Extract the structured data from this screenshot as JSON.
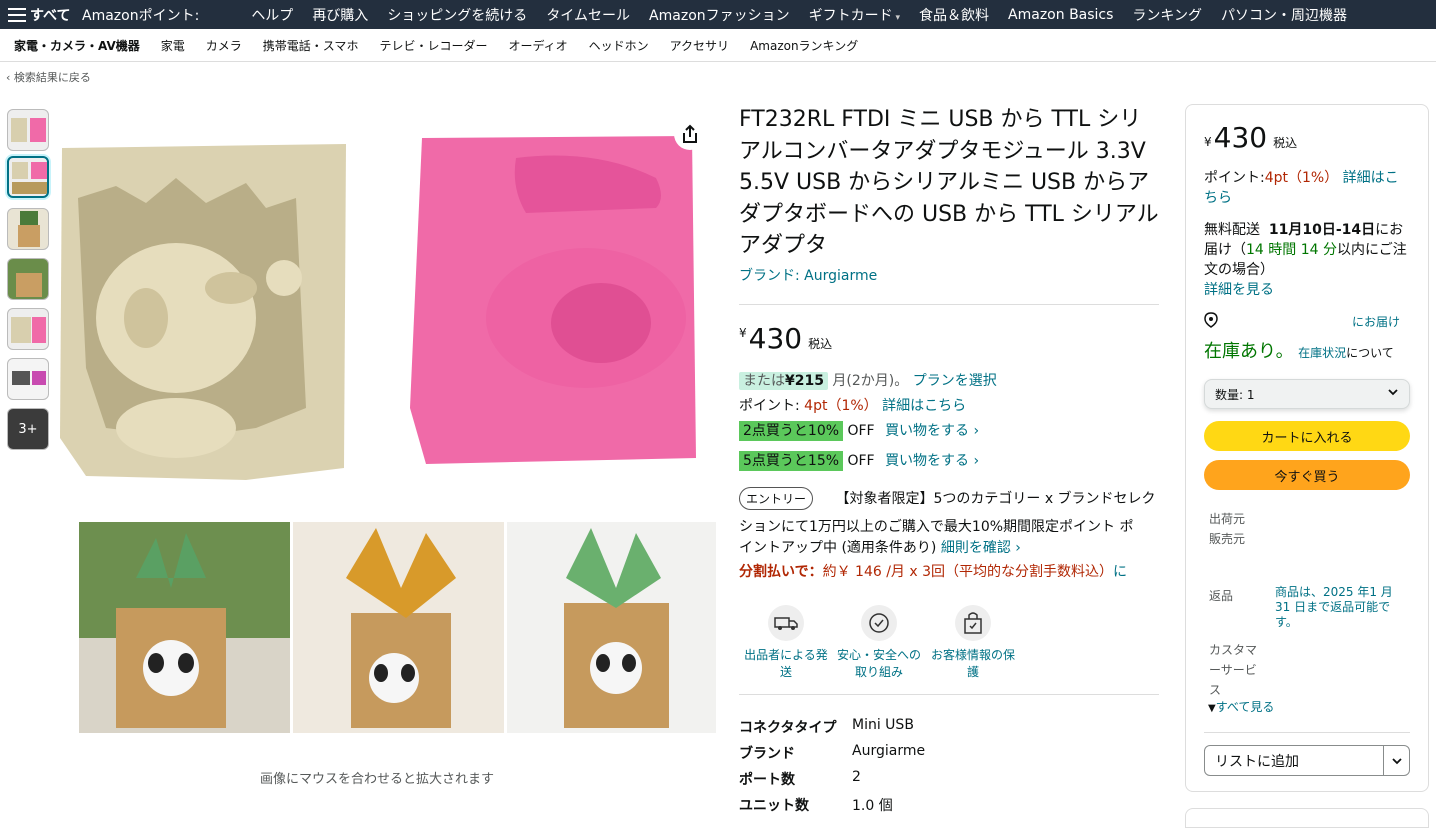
{
  "topnav": {
    "all": "すべて",
    "items": [
      "Amazonポイント:",
      "ヘルプ",
      "再び購入",
      "ショッピングを続ける",
      "タイムセール",
      "Amazonファッション",
      "ギフトカード",
      "食品＆飲料",
      "Amazon Basics",
      "ランキング",
      "パソコン・周辺機器"
    ]
  },
  "subnav": {
    "items": [
      "家電・カメラ・AV機器",
      "家電",
      "カメラ",
      "携帯電話・スマホ",
      "テレビ・レコーダー",
      "オーディオ",
      "ヘッドホン",
      "アクセサリ",
      "Amazonランキング"
    ]
  },
  "back": "‹ 検索結果に戻る",
  "gallery": {
    "more": "3+",
    "hover_hint": "画像にマウスを合わせると拡大されます"
  },
  "product": {
    "title": "FT232RL FTDI ミニ USB から TTL シリアルコンバータアダプタモジュール 3.3V 5.5V USB からシリアルミニ USB からアダプタボードへの USB から TTL シリアルアダプタ",
    "brand": "ブランド: Aurgiarme",
    "currency": "¥",
    "price": "430",
    "tax": "税込",
    "installment_prefix": "または",
    "installment_amount": "¥215",
    "installment_suffix": "月(2か月)。",
    "installment_link": "プランを選択",
    "points_label": "ポイント:",
    "points_value": "4pt（1%）",
    "points_link": "詳細はこちら",
    "promo1_badge": "2点買うと10%",
    "promo1_off": "OFF",
    "promo1_link": "買い物をする ›",
    "promo2_badge": "5点買うと15%",
    "promo2_off": "OFF",
    "promo2_link": "買い物をする ›",
    "entry_tag": "エントリー",
    "entry_text1": "【対象者限定】5つのカテゴリー x ブランドセレク",
    "entry_text2": "ションにて1万円以上のご購入で最大10%期間限定ポイント ポ",
    "entry_text3": "イントアップ中 (適用条件あり)",
    "entry_link": "細則を確認 ›",
    "split_label": "分割払いで：",
    "split_text": "約￥ 146 /月 x 3回（平均的な分割手数料込）",
    "split_tail": "に",
    "features": [
      {
        "icon": "truck-icon",
        "label": "出品者による発送"
      },
      {
        "icon": "shield-check-icon",
        "label": "安心・安全への取り組み"
      },
      {
        "icon": "lock-bag-icon",
        "label": "お客様情報の保護"
      }
    ],
    "specs": [
      {
        "k": "コネクタタイプ",
        "v": "Mini USB"
      },
      {
        "k": "ブランド",
        "v": "Aurgiarme"
      },
      {
        "k": "ポート数",
        "v": "2"
      },
      {
        "k": "ユニット数",
        "v": "1.0 個"
      }
    ]
  },
  "buybox": {
    "currency": "¥",
    "price": "430",
    "tax": "税込",
    "points_label": "ポイント:",
    "points_value": "4pt（1%）",
    "points_link1": "詳細はこ",
    "points_link2": "ちら",
    "delivery1a": "無料配送",
    "delivery1b": "11月10日-14日",
    "delivery1c": "にお",
    "delivery2a": "届け（",
    "delivery2b": "14 時間 14 分",
    "delivery2c": "以内にご注",
    "delivery3": "文の場合）",
    "delivery_link": "詳細を見る",
    "deliver_to": "にお届け",
    "stock": "在庫あり。",
    "stock_link": "在庫状況",
    "stock_tail": "について",
    "qty": "数量: 1",
    "cart": "カートに入れる",
    "buy_now": "今すぐ買う",
    "ship_from": "出荷元",
    "sold_by": "販売元",
    "returns": "返品",
    "returns_text": "商品は、2025 年1 月 31 日まで返品可能です。",
    "cs1": "カスタマ",
    "cs2": "ーサービ",
    "cs3": "ス",
    "see_all": "すべて見る",
    "list": "リストに追加"
  },
  "colors": {
    "nav_bg": "#232f3e",
    "link": "#007185",
    "cart": "#ffd814",
    "buy": "#ffa41c",
    "stock": "#007600",
    "promo_green": "#5bc85b",
    "price_red": "#b12704"
  }
}
